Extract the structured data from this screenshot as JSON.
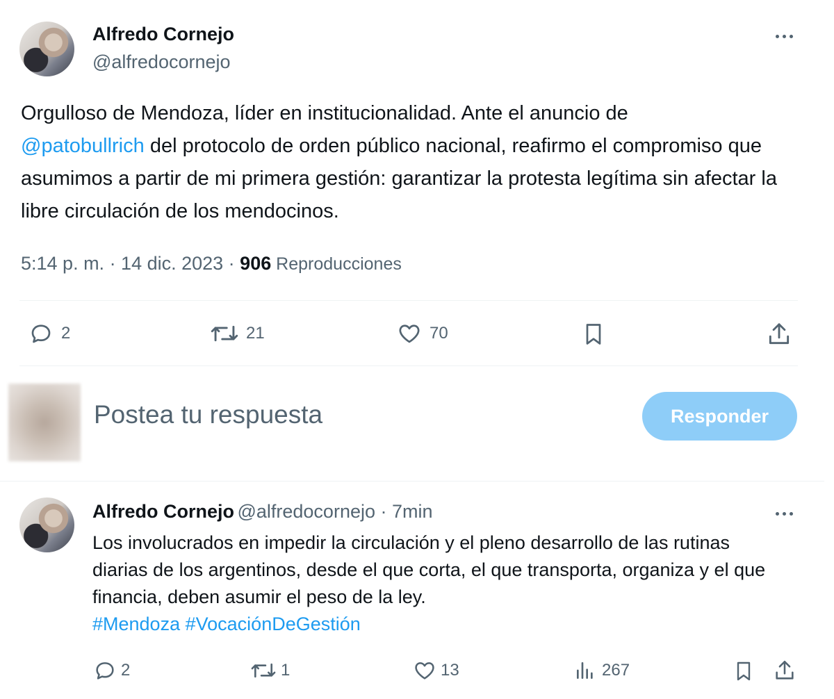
{
  "tweet": {
    "author_name": "Alfredo Cornejo",
    "author_handle": "@alfredocornejo",
    "text_before": "Orgulloso de Mendoza, líder en institucionalidad. Ante el anuncio de",
    "mention": "@patobullrich",
    "text_after": " del protocolo de orden público nacional, reafirmo el compromiso que asumimos a partir de mi primera gestión: garantizar la protesta legítima sin afectar la libre circulación de los mendocinos.",
    "timestamp": "5:14 p. m. · 14 dic. 2023 · ",
    "views_count": "906",
    "views_label": " Reproducciones",
    "actions": {
      "replies": "2",
      "retweets": "21",
      "likes": "70"
    }
  },
  "reply_box": {
    "placeholder": "Postea tu respuesta",
    "button_label": "Responder"
  },
  "reply_tweet": {
    "author_name": "Alfredo Cornejo",
    "author_handle": "@alfredocornejo",
    "time": " · 7min",
    "text": "Los involucrados en impedir la circulación y el pleno desarrollo de las rutinas diarias de los argentinos, desde el que corta, el que transporta, organiza y el que financia, deben asumir el peso de la ley.",
    "hashtag_1": "#Mendoza",
    "hashtag_2": "#VocaciónDeGestión",
    "actions": {
      "replies": "2",
      "retweets": "1",
      "likes": "13",
      "views": "267"
    }
  },
  "icons": {
    "more": "more-horizontal-icon",
    "reply": "reply-bubble-icon",
    "retweet": "retweet-icon",
    "like": "heart-icon",
    "bookmark": "bookmark-icon",
    "share": "share-upload-icon",
    "views": "views-bar-chart-icon"
  },
  "colors": {
    "text": "#0f1419",
    "muted": "#536471",
    "link": "#1d9bf0",
    "button_disabled": "#8ecdf8",
    "divider": "#eff3f4"
  }
}
